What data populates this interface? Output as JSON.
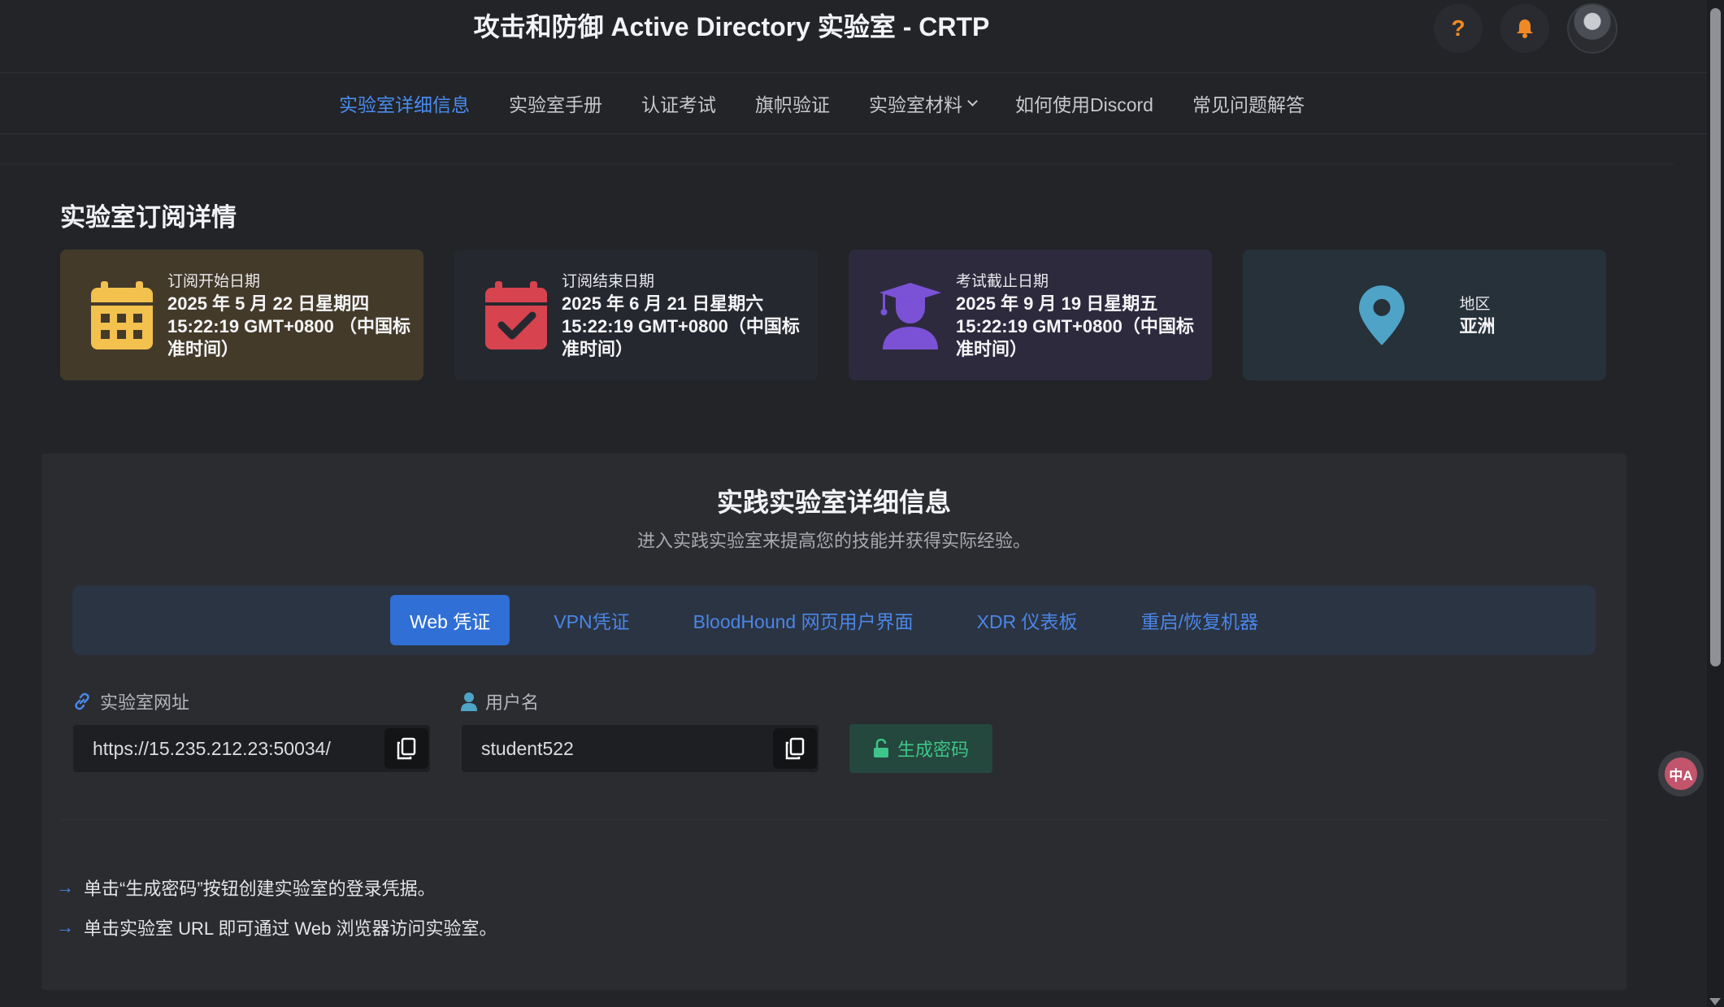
{
  "header": {
    "title": "攻击和防御 Active Directory 实验室 - CRTP",
    "help_label": "?"
  },
  "nav": {
    "items": [
      {
        "label": "实验室详细信息",
        "active": true
      },
      {
        "label": "实验室手册"
      },
      {
        "label": "认证考试"
      },
      {
        "label": "旗帜验证"
      },
      {
        "label": "实验室材料",
        "dropdown": true
      },
      {
        "label": "如何使用Discord"
      },
      {
        "label": "常见问题解答"
      }
    ]
  },
  "subscription": {
    "title": "实验室订阅详情",
    "cards": [
      {
        "label": "订阅开始日期",
        "value": "2025 年 5 月 22 日星期四 15:22:19 GMT+0800 （中国标准时间）",
        "icon": "calendar-icon",
        "color": "#f2c14e"
      },
      {
        "label": "订阅结束日期",
        "value": "2025 年 6 月 21 日星期六 15:22:19 GMT+0800（中国标准时间）",
        "icon": "calendar-check-icon",
        "color": "#d7434e"
      },
      {
        "label": "考试截止日期",
        "value": "2025 年 9 月 19 日星期五 15:22:19 GMT+0800（中国标准时间）",
        "icon": "graduate-icon",
        "color": "#7b52d6"
      },
      {
        "label": "地区",
        "value": "亚洲",
        "icon": "map-pin-icon",
        "color": "#4fa3c7"
      }
    ]
  },
  "practice": {
    "title": "实践实验室详细信息",
    "subtitle": "进入实践实验室来提高您的技能并获得实际经验。",
    "tabs": [
      {
        "label": "Web 凭证",
        "active": true
      },
      {
        "label": "VPN凭证"
      },
      {
        "label": "BloodHound 网页用户界面"
      },
      {
        "label": "XDR 仪表板"
      },
      {
        "label": "重启/恢复机器"
      }
    ],
    "lab_url_label": "实验室网址",
    "lab_url_value": "https://15.235.212.23:50034/",
    "username_label": "用户名",
    "username_value": "student522",
    "generate_label": "生成密码",
    "hints": [
      "单击“生成密码”按钮创建实验室的登录凭据。",
      "单击实验室 URL 即可通过 Web 浏览器访问实验室。"
    ]
  },
  "translate_label": "中A"
}
